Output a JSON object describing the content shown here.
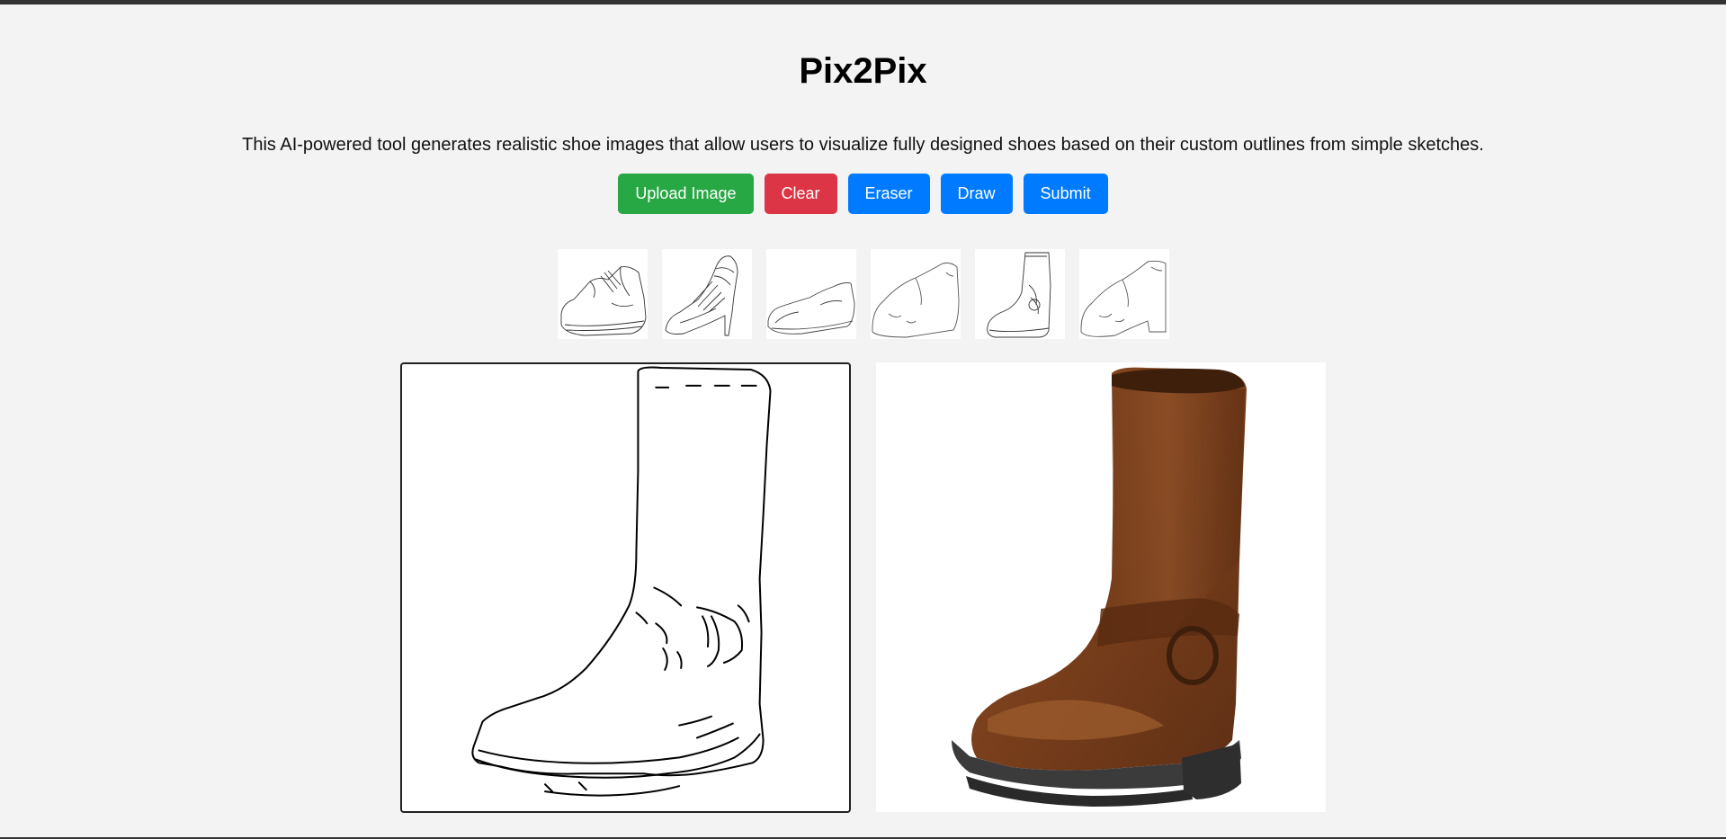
{
  "app": {
    "title": "Pix2Pix",
    "description": "This AI-powered tool generates realistic shoe images that allow users to visualize fully designed shoes based on their custom outlines from simple sketches."
  },
  "toolbar": {
    "buttons": [
      {
        "label": "Upload Image",
        "color": "#28a745"
      },
      {
        "label": "Clear",
        "color": "#dc3545"
      },
      {
        "label": "Eraser",
        "color": "#007bff"
      },
      {
        "label": "Draw",
        "color": "#007bff"
      },
      {
        "label": "Submit",
        "color": "#007bff"
      }
    ]
  },
  "examples": [
    {
      "icon": "oxford-shoe-sketch"
    },
    {
      "icon": "high-heel-sketch"
    },
    {
      "icon": "flat-shoe-sketch"
    },
    {
      "icon": "loafer-sketch"
    },
    {
      "icon": "ankle-boot-sketch"
    },
    {
      "icon": "heeled-loafer-sketch"
    }
  ],
  "canvas": {
    "icon": "boot-sketch"
  },
  "output": {
    "icon": "generated-brown-boot"
  }
}
